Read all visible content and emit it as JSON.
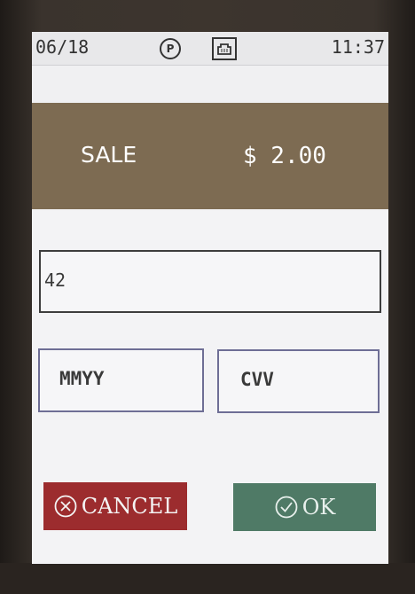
{
  "status_bar": {
    "date": "06/18",
    "time": "11:37",
    "icons": [
      "p-circle-icon",
      "network-port-icon"
    ],
    "p_icon_letter": "P"
  },
  "transaction": {
    "type": "SALE",
    "amount": "$ 2.00"
  },
  "form": {
    "card_number_value": "42",
    "expiry_placeholder": "MMYY",
    "cvv_placeholder": "CVV"
  },
  "buttons": {
    "cancel_label": "CANCEL",
    "cancel_icon": "x-circle-icon",
    "ok_label": "OK",
    "ok_icon": "check-circle-icon"
  },
  "colors": {
    "header_band": "#7d6b52",
    "cancel": "#9c2c2e",
    "ok": "#4f7a66"
  }
}
